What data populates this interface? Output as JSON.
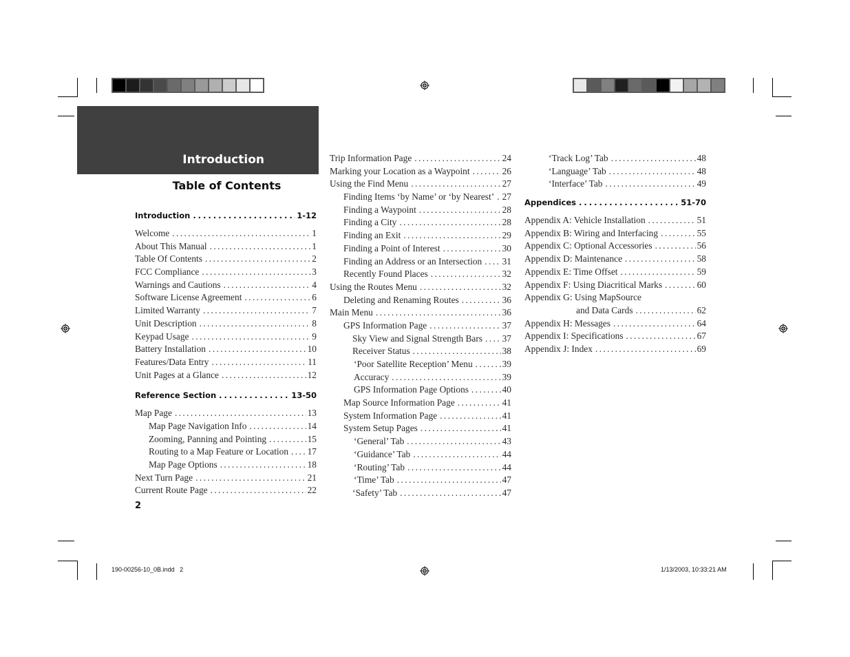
{
  "header": {
    "chapter": "Introduction",
    "toc_title": "Table of Contents"
  },
  "page_number": "2",
  "slug": {
    "file": "190-00256-10_0B.indd   2",
    "timestamp": "1/13/2003, 10:33:21 AM"
  },
  "colors": {
    "header_band": "#404040",
    "left_swatches": [
      "#000000",
      "#1c1c1c",
      "#333333",
      "#4a4a4a",
      "#6a6a6a",
      "#808080",
      "#999999",
      "#b0b0b0",
      "#cccccc",
      "#e6e6e6",
      "#ffffff"
    ],
    "right_swatches": [
      "#e8e8e8",
      "#5a5a5a",
      "#808080",
      "#202020",
      "#6a6a6a",
      "#5a5a5a",
      "#000000",
      "#f2f2f2",
      "#a6a6a6",
      "#b3b3b3",
      "#808080"
    ]
  },
  "columns": [
    [
      {
        "label": "Introduction",
        "page": "1-12",
        "type": "section"
      },
      {
        "type": "gap"
      },
      {
        "label": "Welcome",
        "page": "1",
        "indent": 0
      },
      {
        "label": "About This Manual",
        "page": "1",
        "indent": 0
      },
      {
        "label": "Table Of Contents",
        "page": "2",
        "indent": 0
      },
      {
        "label": "FCC Compliance",
        "page": "3",
        "indent": 0
      },
      {
        "label": "Warnings and Cautions",
        "page": "4",
        "indent": 0
      },
      {
        "label": "Software License Agreement",
        "page": "6",
        "indent": 0
      },
      {
        "label": "Limited Warranty",
        "page": "7",
        "indent": 0
      },
      {
        "label": "Unit Description",
        "page": "8",
        "indent": 0
      },
      {
        "label": "Keypad Usage",
        "page": "9",
        "indent": 0
      },
      {
        "label": "Battery Installation",
        "page": "10",
        "indent": 0
      },
      {
        "label": "Features/Data Entry",
        "page": "11",
        "indent": 0
      },
      {
        "label": "Unit Pages at a Glance",
        "page": "12",
        "indent": 0
      },
      {
        "type": "gap2"
      },
      {
        "label": "Reference Section",
        "page": "13-50",
        "type": "section"
      },
      {
        "type": "gap"
      },
      {
        "label": "Map Page",
        "page": "13",
        "indent": 0
      },
      {
        "label": "Map Page Navigation Info",
        "page": "14",
        "indent": 1
      },
      {
        "label": "Zooming, Panning and Pointing",
        "page": "15",
        "indent": 1
      },
      {
        "label": "Routing to a Map Feature or Location",
        "page": "17",
        "indent": 1
      },
      {
        "label": "Map Page Options",
        "page": "18",
        "indent": 1
      },
      {
        "label": "Next Turn Page",
        "page": "21",
        "indent": 0
      },
      {
        "label": "Current Route Page",
        "page": "22",
        "indent": 0
      }
    ],
    [
      {
        "label": "Trip Information Page",
        "page": "24",
        "indent": 0
      },
      {
        "label": "Marking your Location as a Waypoint",
        "page": "26",
        "indent": 0
      },
      {
        "label": "Using the Find Menu",
        "page": "27",
        "indent": 0
      },
      {
        "label": "Finding Items ‘by Name’ or ‘by Nearest’",
        "page": "27",
        "indent": 1
      },
      {
        "label": "Finding a Waypoint",
        "page": "28",
        "indent": 1
      },
      {
        "label": "Finding a City",
        "page": "28",
        "indent": 1
      },
      {
        "label": "Finding an Exit",
        "page": "29",
        "indent": 1
      },
      {
        "label": "Finding a Point of Interest",
        "page": "30",
        "indent": 1
      },
      {
        "label": "Finding an Address or an Intersection",
        "page": "31",
        "indent": 1
      },
      {
        "label": "Recently Found Places",
        "page": "32",
        "indent": 1
      },
      {
        "label": "Using the Routes Menu",
        "page": "32",
        "indent": 0
      },
      {
        "label": "Deleting and Renaming Routes",
        "page": "36",
        "indent": 1
      },
      {
        "label": "Main Menu",
        "page": "36",
        "indent": 0
      },
      {
        "label": "GPS Information Page",
        "page": "37",
        "indent": 1
      },
      {
        "label": "Sky View and Signal Strength Bars",
        "page": "37",
        "indent": 2
      },
      {
        "label": "Receiver Status",
        "page": "38",
        "indent": 2
      },
      {
        "label": "‘Poor Satellite Reception’ Menu",
        "page": "39",
        "indent": 3
      },
      {
        "label": "Accuracy",
        "page": "39",
        "indent": 3
      },
      {
        "label": "GPS Information Page Options",
        "page": "40",
        "indent": 3
      },
      {
        "label": "Map Source Information Page",
        "page": "41",
        "indent": 1
      },
      {
        "label": "System Information Page",
        "page": "41",
        "indent": 1
      },
      {
        "label": "System Setup Pages",
        "page": "41",
        "indent": 1
      },
      {
        "label": "‘General’ Tab",
        "page": "43",
        "indent": 3
      },
      {
        "label": "‘Guidance’ Tab",
        "page": "44",
        "indent": 3
      },
      {
        "label": "‘Routing’ Tab",
        "page": "44",
        "indent": 3
      },
      {
        "label": "‘Time’ Tab",
        "page": "47",
        "indent": 3
      },
      {
        "label": "‘Safety’ Tab",
        "page": "47",
        "indent": 2
      }
    ],
    [
      {
        "label": "‘Track Log’ Tab",
        "page": "48",
        "indent": 3
      },
      {
        "label": "‘Language’ Tab",
        "page": "48",
        "indent": 3
      },
      {
        "label": "‘Interface’ Tab",
        "page": "49",
        "indent": 3
      },
      {
        "type": "gap"
      },
      {
        "label": "Appendices",
        "page": "51-70",
        "type": "section"
      },
      {
        "type": "gap"
      },
      {
        "label": "Appendix A:  Vehicle Installation",
        "page": "51",
        "indent": 0
      },
      {
        "label": "Appendix B:  Wiring and Interfacing",
        "page": "55",
        "indent": 0
      },
      {
        "label": "Appendix C:  Optional Accessories",
        "page": "56",
        "indent": 0
      },
      {
        "label": "Appendix D:  Maintenance",
        "page": "58",
        "indent": 0
      },
      {
        "label": "Appendix E:  Time Offset",
        "page": "59",
        "indent": 0
      },
      {
        "label": "Appendix F:  Using Diacritical Marks",
        "page": "60",
        "indent": 0
      },
      {
        "label": "Appendix G:  Using MapSource",
        "page": "",
        "type": "nopage",
        "indent": 0
      },
      {
        "label": "and Data Cards",
        "page": "62",
        "indent": 4
      },
      {
        "label": "Appendix H:  Messages",
        "page": "64",
        "indent": 0
      },
      {
        "label": "Appendix I:   Specifications",
        "page": "67",
        "indent": 0
      },
      {
        "label": "Appendix J:   Index",
        "page": "69",
        "indent": 0
      }
    ]
  ]
}
